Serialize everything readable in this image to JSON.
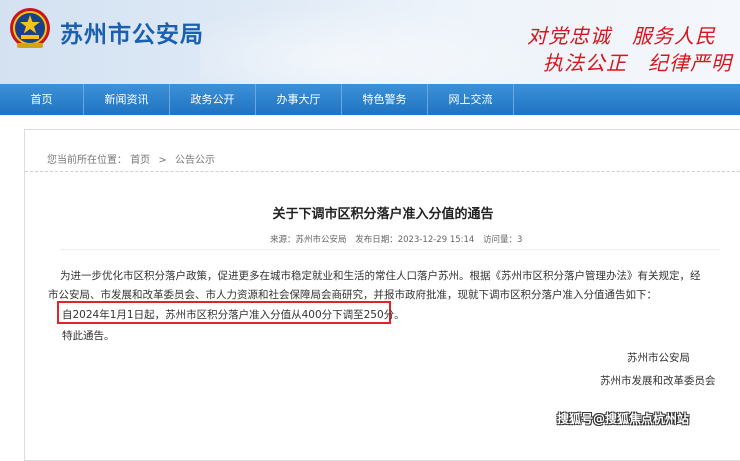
{
  "header": {
    "site_title": "苏州市公安局",
    "slogan_line1": "对党忠诚　服务人民",
    "slogan_line2": "执法公正　纪律严明"
  },
  "nav": {
    "items": [
      "首页",
      "新闻资讯",
      "政务公开",
      "办事大厅",
      "特色警务",
      "网上交流"
    ]
  },
  "breadcrumb": {
    "prefix": "您当前所在位置：",
    "items": [
      "首页",
      "公告公示"
    ],
    "separator": ">"
  },
  "article": {
    "title": "关于下调市区积分落户准入分值的通告",
    "meta": {
      "source": "来源：苏州市公安局",
      "date": "发布日期：2023-12-29 15:14",
      "views": "访问量：3"
    },
    "paragraph1_line1": "为进一步优化市区积分落户政策，促进更多在城市稳定就业和生活的常住人口落户苏州。根据《苏州市区积分落户管理办法》有关规定，经",
    "paragraph1_line2": "市公安局、市发展和改革委员会、市人力资源和社会保障局会商研究，并报市政府批准，现就下调市区积分落户准入分值通告如下：",
    "highlighted": "自2024年1月1日起，苏州市区积分落户准入分值从400分下调至250分。",
    "closing": "特此通告。",
    "signatory1": "苏州市公安局",
    "signatory2": "苏州市发展和改革委员会"
  },
  "watermark": "搜狐号@搜狐焦点杭州站",
  "colors": {
    "nav_blue": "#1f73c1",
    "title_blue": "#1b5fb0",
    "slogan_red": "#d6161e",
    "highlight_red": "#e0242a"
  }
}
